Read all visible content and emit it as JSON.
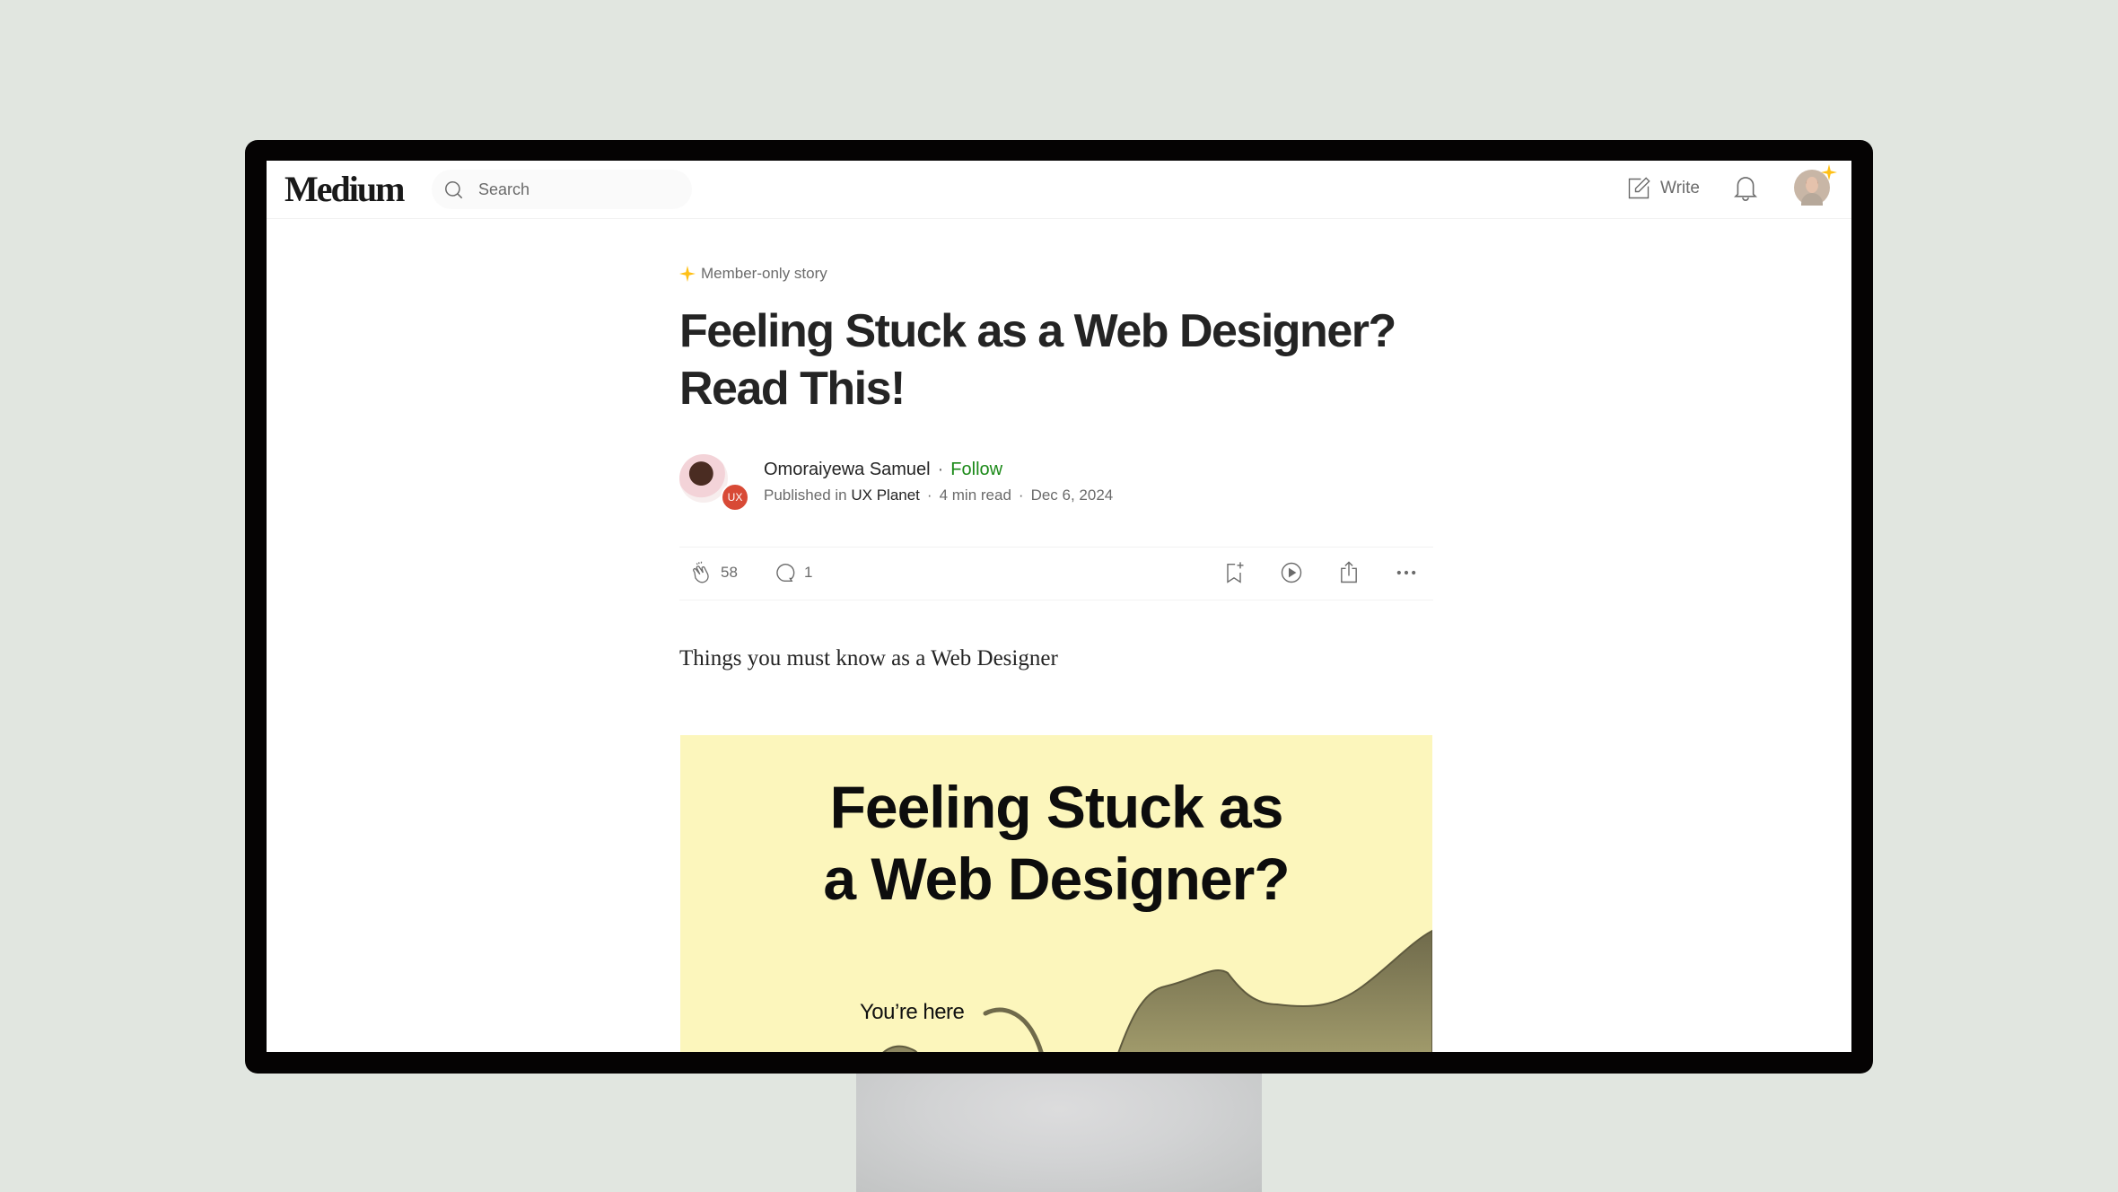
{
  "header": {
    "logo": "Medium",
    "search_placeholder": "Search",
    "write_label": "Write",
    "icons": [
      "search-icon",
      "write-icon",
      "bell-icon",
      "avatar"
    ]
  },
  "article": {
    "member_badge": "Member-only story",
    "title": "Feeling Stuck as a Web Designer? Read This!",
    "author": {
      "name": "Omoraiyewa Samuel",
      "follow_label": "Follow",
      "avatar_badge": "UX",
      "published_prefix": "Published in",
      "publication": "UX Planet",
      "read_time": "4 min read",
      "date": "Dec 6, 2024"
    },
    "actions": {
      "claps": "58",
      "responses": "1",
      "icons": [
        "clap-icon",
        "comment-icon",
        "bookmark-add-icon",
        "play-icon",
        "share-icon",
        "more-icon"
      ]
    },
    "subtitle": "Things you must know as a Web Designer",
    "hero_image": {
      "headline": "Feeling Stuck as a Web Designer?",
      "headline_line1": "Feeling Stuck as",
      "headline_line2": "a Web Designer?",
      "annotation": "You’re here"
    }
  },
  "colors": {
    "background": "#e1e6e0",
    "bezel": "#050303",
    "text": "#242424",
    "muted": "#6b6b6b",
    "follow_green": "#1a8917",
    "member_star": "#ffc017",
    "hero_bg": "#fcf6bc",
    "hill": "#7d7755"
  }
}
